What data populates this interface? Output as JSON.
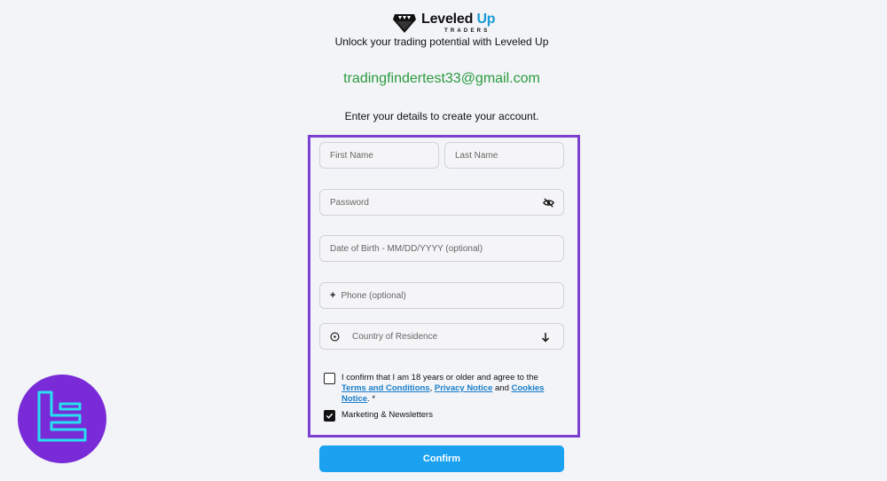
{
  "logo": {
    "title_main": "Leveled ",
    "title_accent": "Up",
    "subtitle": "TRADERS"
  },
  "tagline": "Unlock your trading potential with Leveled Up",
  "email": "tradingfindertest33@gmail.com",
  "instructions": "Enter your details to create your account.",
  "form": {
    "first_name_placeholder": "First Name",
    "last_name_placeholder": "Last Name",
    "password_placeholder": "Password",
    "dob_placeholder": "Date of Birth - MM/DD/YYYY (optional)",
    "phone_prefix": "+",
    "phone_placeholder": "Phone (optional)",
    "country_placeholder": "Country of Residence",
    "terms": {
      "prefix": "I confirm that I am 18 years or older and agree to the ",
      "terms_link": "Terms and Conditions",
      "sep1": ", ",
      "privacy_link": "Privacy Notice",
      "sep2": " and ",
      "cookies_link": "Cookies Notice",
      "suffix": ". *",
      "checked": false
    },
    "newsletter": {
      "label": "Marketing & Newsletters",
      "checked": true
    },
    "confirm_label": "Confirm"
  },
  "icons": {
    "logo": "diamond-icon",
    "password_toggle": "eye-off-icon",
    "country": "globe-icon",
    "dropdown": "arrow-down-icon",
    "watermark": "tradingfinder-logo"
  },
  "colors": {
    "accent": "#1a9ad6",
    "email": "#2a9a3c",
    "form_border": "#7b3fd2",
    "confirm_button": "#1aa2f0",
    "link": "#1a7ec9",
    "badge": "#7a2bd8"
  }
}
